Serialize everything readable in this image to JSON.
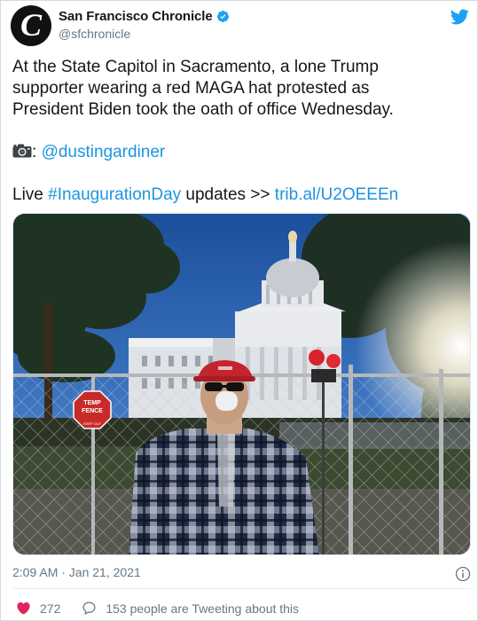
{
  "account": {
    "display_name": "San Francisco Chronicle",
    "handle": "@sfchronicle",
    "avatar_letter": "C",
    "verified": true
  },
  "tweet": {
    "line1": "At the State Capitol in Sacramento, a lone Trump",
    "line2": "supporter wearing a red MAGA hat protested as",
    "line3": "President Biden took the oath of office Wednesday.",
    "photo_credit_sep": ":",
    "photo_credit_handle": "@dustingardiner",
    "live_prefix": "Live ",
    "hashtag": "#InaugurationDay",
    "live_middle": " updates >> ",
    "short_link": "trib.al/U2OEEEn"
  },
  "photo": {
    "sign_line1": "TEMP",
    "sign_line2": "FENCE",
    "sign_line3": "",
    "sign_line4": "KEEP OUT"
  },
  "meta": {
    "timestamp": "2:09 AM · Jan 21, 2021"
  },
  "actions": {
    "likes": "272",
    "conversation": "153 people are Tweeting about this"
  },
  "colors": {
    "link": "#1b95e0",
    "twitter_blue": "#1da1f2",
    "like_red": "#e0245e",
    "secondary_text": "#657786"
  },
  "icons": {
    "verified": "verified-badge-icon",
    "brand": "twitter-bird-icon",
    "camera": "camera-icon",
    "info": "info-icon",
    "like": "heart-icon",
    "reply": "speech-bubble-icon"
  }
}
